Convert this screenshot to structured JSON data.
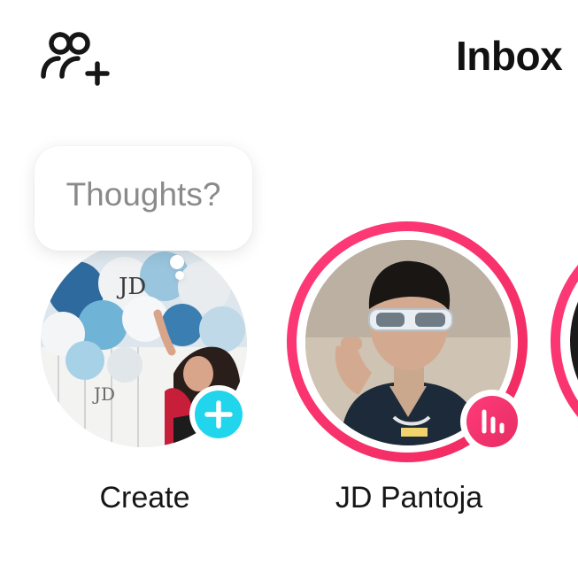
{
  "header": {
    "title": "Inbox",
    "add_friends_icon": "add-friends-icon"
  },
  "stories": {
    "create": {
      "label": "Create",
      "bubble_text": "Thoughts?",
      "badge_icon": "plus-icon",
      "accent": "#20d5ec"
    },
    "jd": {
      "label": "JD Pantoja",
      "badge_icon": "audio-bars-icon",
      "ring_color": "#f2306a"
    }
  },
  "colors": {
    "accent_cyan": "#20d5ec",
    "story_ring_pink": "#f2306a",
    "text_primary": "#161616",
    "text_muted": "#8a8a8a"
  }
}
